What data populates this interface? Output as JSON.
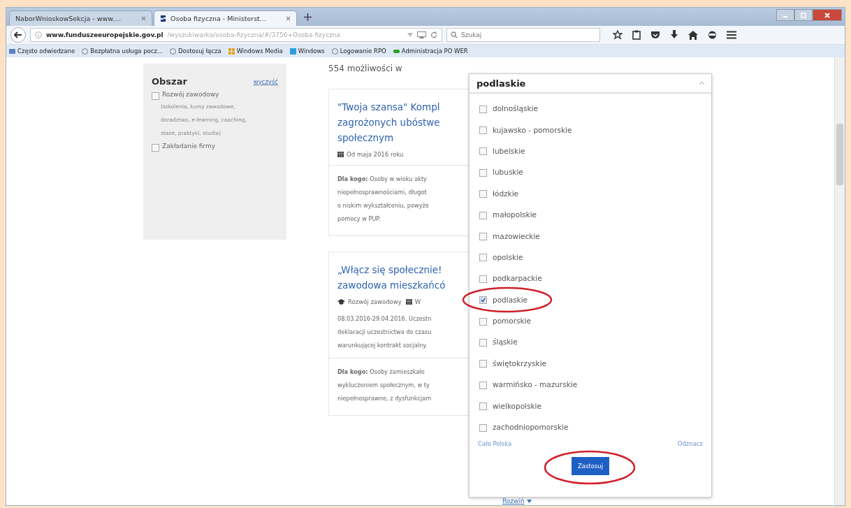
{
  "tabs": [
    {
      "title": "NaborWnioskowSekcja - www....",
      "selected": false
    },
    {
      "title": "Osoba fizyczna - Ministerst...",
      "selected": true
    }
  ],
  "address": {
    "host": "www.funduszeeuropejskie.gov.pl",
    "path": "/wyszukiwarka/osoba-fizyczna/#/3756+Osoba fizyczna"
  },
  "search": {
    "placeholder": "Szukaj"
  },
  "bookmarks": [
    "Często odwiedzane",
    "Bezpłatna usługa pocz...",
    "Dostosuj łącza",
    "Windows Media",
    "Windows",
    "Logowanie RPO",
    "Administracja PO WER"
  ],
  "sidebar": {
    "title": "Obszar",
    "clear_link": "wyczyść",
    "options": [
      {
        "label": "Rozwój zawodowy",
        "note": "(szkolenia, kursy zawodowe, doradztwo, e-learning, coaching, staże, praktyki, studia)",
        "checked": false
      },
      {
        "label": "Zakładanie firmy",
        "checked": false
      }
    ]
  },
  "results_count": "554 możliwości w",
  "cards": [
    {
      "title_lines": [
        "\"Twoja szansa\" Kompl",
        "zagrożonych ubóstwe",
        "społecznym"
      ],
      "meta": [
        {
          "kind": "calendar",
          "text": "Od maja 2016 roku"
        }
      ],
      "audience_lines": [
        "**Dla kogo:** Osoby w wieku akty",
        "niepełnosprawnościami, długot",
        "o niskim wykształceniu, powyże",
        "pomocy w PUP."
      ]
    },
    {
      "title_lines": [
        "„Włącz się społecznie!",
        "zawodowa mieszkańcó"
      ],
      "meta": [
        {
          "kind": "graduation",
          "text": "Rozwój zawodowy"
        },
        {
          "kind": "calendar",
          "text": "W"
        }
      ],
      "detail_lines": [
        "08.03.2016-29.04.2016. Uczestn",
        "deklaracji uczestnictwa do czasu",
        "warunkującej kontrakt socjalny."
      ],
      "audience_lines": [
        "**Dla kogo:** Osoby zamieszkałe",
        "wykluczeniem społecznym, w ty",
        "niepełnosprawne, z dysfunkcjam"
      ]
    }
  ],
  "expand_link": "Rozwiń",
  "dropdown": {
    "value": "podlaskie",
    "expanded": true,
    "items": [
      {
        "label": "dolnośląskie",
        "checked": false,
        "highlighted": false
      },
      {
        "label": "kujawsko - pomorskie",
        "checked": false,
        "highlighted": false
      },
      {
        "label": "lubelskie",
        "checked": false,
        "highlighted": false
      },
      {
        "label": "lubuskie",
        "checked": false,
        "highlighted": false
      },
      {
        "label": "łódzkie",
        "checked": false,
        "highlighted": false
      },
      {
        "label": "małopolskie",
        "checked": false,
        "highlighted": false
      },
      {
        "label": "mazowieckie",
        "checked": false,
        "highlighted": false
      },
      {
        "label": "opolskie",
        "checked": false,
        "highlighted": false
      },
      {
        "label": "podkarpackie",
        "checked": false,
        "highlighted": false
      },
      {
        "label": "podlaskie",
        "checked": true,
        "highlighted": true
      },
      {
        "label": "pomorskie",
        "checked": false,
        "highlighted": false
      },
      {
        "label": "śląskie",
        "checked": false,
        "highlighted": false
      },
      {
        "label": "świętokrzyskie",
        "checked": false,
        "highlighted": false
      },
      {
        "label": "warmińsko - mazurskie",
        "checked": false,
        "highlighted": false
      },
      {
        "label": "wielkopolskie",
        "checked": false,
        "highlighted": false
      },
      {
        "label": "zachodniopomorskie",
        "checked": false,
        "highlighted": false
      }
    ],
    "select_all_link": "Cała Polska",
    "clear_link": "Odznacz",
    "apply_button": {
      "label": "Zastosuj",
      "highlighted": true
    }
  }
}
